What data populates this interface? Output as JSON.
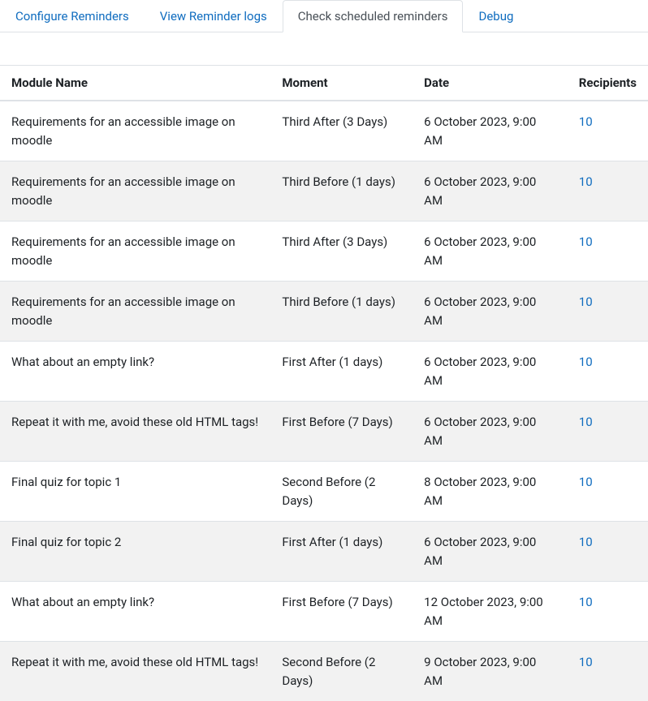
{
  "tabs": [
    {
      "label": "Configure Reminders",
      "active": false
    },
    {
      "label": "View Reminder logs",
      "active": false
    },
    {
      "label": "Check scheduled reminders",
      "active": true
    },
    {
      "label": "Debug",
      "active": false
    }
  ],
  "table": {
    "headers": {
      "module": "Module Name",
      "moment": "Moment",
      "date": "Date",
      "recipients": "Recipients"
    },
    "rows": [
      {
        "module": "Requirements for an accessible image on moodle",
        "moment": "Third After (3 Days)",
        "date": "6 October 2023, 9:00 AM",
        "recipients": "10"
      },
      {
        "module": "Requirements for an accessible image on moodle",
        "moment": "Third Before (1 days)",
        "date": "6 October 2023, 9:00 AM",
        "recipients": "10"
      },
      {
        "module": "Requirements for an accessible image on moodle",
        "moment": "Third After (3 Days)",
        "date": "6 October 2023, 9:00 AM",
        "recipients": "10"
      },
      {
        "module": "Requirements for an accessible image on moodle",
        "moment": "Third Before (1 days)",
        "date": "6 October 2023, 9:00 AM",
        "recipients": "10"
      },
      {
        "module": "What about an empty link?",
        "moment": "First After (1 days)",
        "date": "6 October 2023, 9:00 AM",
        "recipients": "10"
      },
      {
        "module": "Repeat it with me, avoid these old HTML tags!",
        "moment": "First Before (7 Days)",
        "date": "6 October 2023, 9:00 AM",
        "recipients": "10"
      },
      {
        "module": "Final quiz for topic 1",
        "moment": "Second Before (2 Days)",
        "date": "8 October 2023, 9:00 AM",
        "recipients": "10"
      },
      {
        "module": "Final quiz for topic 2",
        "moment": "First After (1 days)",
        "date": "6 October 2023, 9:00 AM",
        "recipients": "10"
      },
      {
        "module": "What about an empty link?",
        "moment": "First Before (7 Days)",
        "date": "12 October 2023, 9:00 AM",
        "recipients": "10"
      },
      {
        "module": "Repeat it with me, avoid these old HTML tags!",
        "moment": "Second Before (2 Days)",
        "date": "9 October 2023, 9:00 AM",
        "recipients": "10"
      }
    ]
  }
}
